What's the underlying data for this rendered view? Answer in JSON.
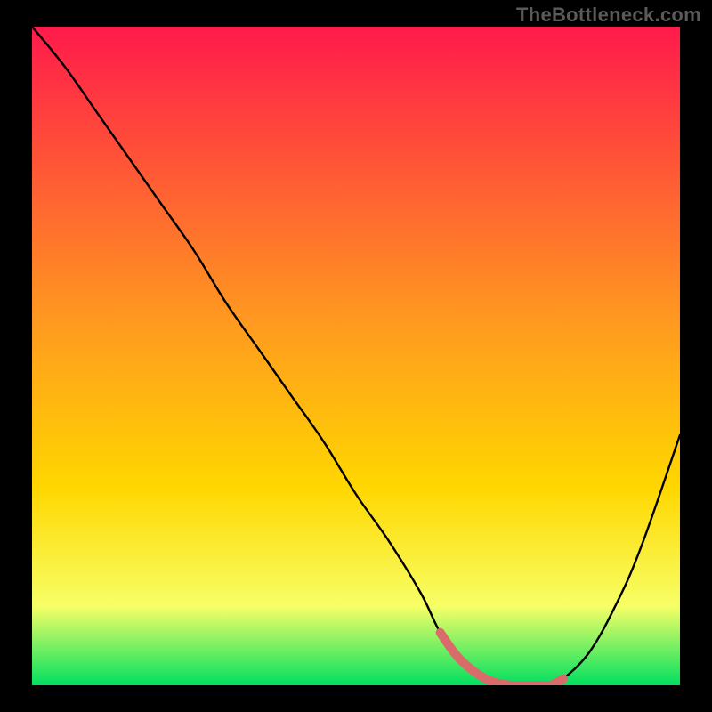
{
  "watermark": "TheBottleneck.com",
  "colors": {
    "black": "#000000",
    "curve": "#000000",
    "highlight": "#d96b6b",
    "gradient_top": "#ff1a4b",
    "gradient_mid": "#ffd700",
    "gradient_low": "#f7ff66",
    "gradient_bottom": "#00e060"
  },
  "chart_data": {
    "type": "line",
    "title": "",
    "xlabel": "",
    "ylabel": "",
    "xlim": [
      0,
      100
    ],
    "ylim": [
      0,
      100
    ],
    "grid": false,
    "legend": false,
    "annotations": [
      {
        "text": "TheBottleneck.com",
        "position": "top-right"
      }
    ],
    "series": [
      {
        "name": "bottleneck-curve",
        "x": [
          0,
          5,
          10,
          15,
          20,
          25,
          30,
          35,
          40,
          45,
          50,
          55,
          60,
          63,
          66,
          70,
          74,
          78,
          80,
          82,
          86,
          90,
          94,
          100
        ],
        "values": [
          100,
          94,
          87,
          80,
          73,
          66,
          58,
          51,
          44,
          37,
          29,
          22,
          14,
          8,
          4,
          1,
          0,
          0,
          0,
          1,
          5,
          12,
          21,
          38
        ]
      },
      {
        "name": "optimal-segment-highlight",
        "x": [
          63,
          66,
          70,
          74,
          78,
          80,
          82
        ],
        "values": [
          8,
          4,
          1,
          0,
          0,
          0,
          1
        ]
      }
    ]
  }
}
